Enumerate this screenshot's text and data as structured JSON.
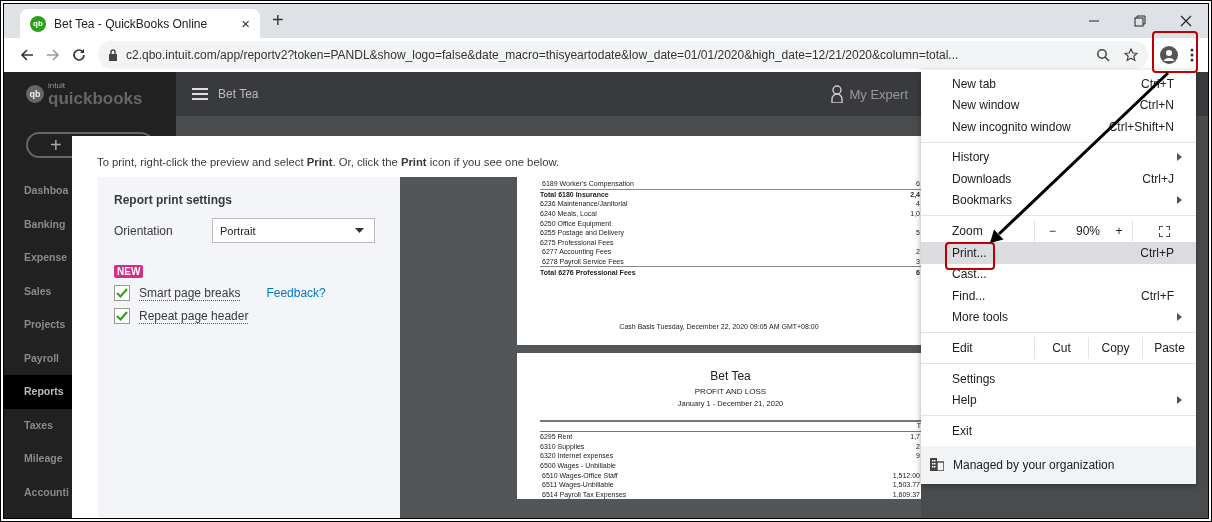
{
  "browser": {
    "tab": {
      "favicon": "qb",
      "title": "Bet Tea - QuickBooks Online",
      "close": "×"
    },
    "new_tab": "+",
    "address": "c2.qbo.intuit.com/app/reportv2?token=PANDL&show_logo=false&date_macro=thisyeartodate&low_date=01/01/2020&high_date=12/21/2020&column=total..."
  },
  "app": {
    "logo": {
      "mark": "qb",
      "small": "intuit",
      "name": "quickbooks"
    },
    "new_button": "+",
    "company": "Bet Tea",
    "experts": "My Expert",
    "nav": [
      {
        "label": "Dashboa",
        "selected": false
      },
      {
        "label": "Banking",
        "selected": false
      },
      {
        "label": "Expense",
        "selected": false
      },
      {
        "label": "Sales",
        "selected": false
      },
      {
        "label": "Projects",
        "selected": false
      },
      {
        "label": "Payroll",
        "selected": false
      },
      {
        "label": "Reports",
        "selected": true
      },
      {
        "label": "Taxes",
        "selected": false
      },
      {
        "label": "Mileage",
        "selected": false
      },
      {
        "label": "Accounti",
        "selected": false
      }
    ]
  },
  "print_dialog": {
    "instruction": "To print, right-click the preview and select **Print**. Or, click the **Print** icon if you see one below.",
    "settings": {
      "title": "Report print settings",
      "orientation_label": "Orientation",
      "orientation": "Portrait",
      "badge": "NEW",
      "feedback": "Feedback?",
      "options": [
        {
          "label": "Smart page breaks",
          "checked": true
        },
        {
          "label": "Repeat page header",
          "checked": true
        }
      ]
    },
    "pages": [
      {
        "rows": [
          {
            "kind": "subline",
            "name": "6189 Worker's Compensation",
            "amount": "6"
          },
          {
            "kind": "total",
            "name": "Total 6180 Insurance",
            "amount": "2,4"
          },
          {
            "kind": "line",
            "name": "6236 Maintenance/Janitorial",
            "amount": "4"
          },
          {
            "kind": "line",
            "name": "6240 Meals, Local",
            "amount": "1,0"
          },
          {
            "kind": "line",
            "name": "6250 Office Equipment",
            "amount": ""
          },
          {
            "kind": "line",
            "name": "6255 Postage and Delivery",
            "amount": "5"
          },
          {
            "kind": "line",
            "name": "6275 Professional Fees",
            "amount": ""
          },
          {
            "kind": "subline",
            "name": "6277 Accounting Fees",
            "amount": "2"
          },
          {
            "kind": "subline",
            "name": "6278 Payroll Service Fees",
            "amount": "3"
          },
          {
            "kind": "total",
            "name": "Total 6276 Professional Fees",
            "amount": "6"
          }
        ],
        "footer": "Cash Basis  Tuesday, December 22, 2020 09:05 AM GMT+08:00"
      },
      {
        "company": "Bet Tea",
        "report": "PROFIT AND LOSS",
        "period": "January 1 - December 21, 2020",
        "column": "T",
        "rows": [
          {
            "kind": "line",
            "name": "6295 Rent",
            "amount": "1,7"
          },
          {
            "kind": "line",
            "name": "6310 Supplies",
            "amount": "2"
          },
          {
            "kind": "line",
            "name": "6320 Internet expenses",
            "amount": "9"
          },
          {
            "kind": "line",
            "name": "6500 Wages - Unbillable",
            "amount": ""
          },
          {
            "kind": "subline",
            "name": "6510 Wages-Office Staff",
            "amount": "1,512.00"
          },
          {
            "kind": "subline",
            "name": "6511 Wages-Unbillable",
            "amount": "1,503.77"
          },
          {
            "kind": "subline",
            "name": "6514 Payroll Tax Expenses",
            "amount": "1,609.37"
          }
        ]
      }
    ]
  },
  "menu": {
    "items": [
      {
        "kind": "item",
        "label": "New tab",
        "shortcut": "Ctrl+T",
        "submenu": false,
        "highlighted": false
      },
      {
        "kind": "item",
        "label": "New window",
        "shortcut": "Ctrl+N",
        "submenu": false,
        "highlighted": false
      },
      {
        "kind": "item",
        "label": "New incognito window",
        "shortcut": "Ctrl+Shift+N",
        "submenu": false,
        "highlighted": false
      },
      {
        "kind": "separator"
      },
      {
        "kind": "item",
        "label": "History",
        "submenu": true,
        "highlighted": false
      },
      {
        "kind": "item",
        "label": "Downloads",
        "shortcut": "Ctrl+J",
        "submenu": false,
        "highlighted": false
      },
      {
        "kind": "item",
        "label": "Bookmarks",
        "submenu": true,
        "highlighted": false
      },
      {
        "kind": "separator"
      },
      {
        "kind": "zoom",
        "label": "Zoom",
        "minus": "−",
        "value": "90%",
        "plus": "+"
      },
      {
        "kind": "item",
        "label": "Print...",
        "shortcut": "Ctrl+P",
        "submenu": false,
        "highlighted": true
      },
      {
        "kind": "item",
        "label": "Cast...",
        "submenu": false,
        "highlighted": false
      },
      {
        "kind": "item",
        "label": "Find...",
        "shortcut": "Ctrl+F",
        "submenu": false,
        "highlighted": false
      },
      {
        "kind": "item",
        "label": "More tools",
        "submenu": true,
        "highlighted": false
      },
      {
        "kind": "separator"
      },
      {
        "kind": "edit",
        "label": "Edit",
        "actions": [
          "Cut",
          "Copy",
          "Paste"
        ]
      },
      {
        "kind": "separator"
      },
      {
        "kind": "item",
        "label": "Settings",
        "submenu": false,
        "highlighted": false
      },
      {
        "kind": "item",
        "label": "Help",
        "submenu": true,
        "highlighted": false
      },
      {
        "kind": "separator"
      },
      {
        "kind": "item",
        "label": "Exit",
        "submenu": false,
        "highlighted": false
      },
      {
        "kind": "footer",
        "label": "Managed by your organization"
      }
    ]
  }
}
